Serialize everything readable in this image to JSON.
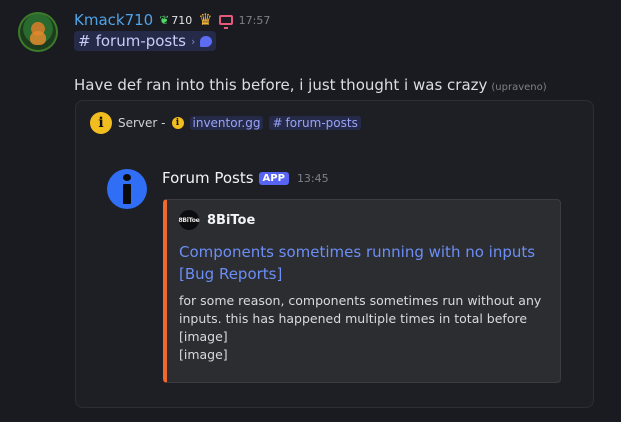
{
  "message": {
    "username": "Kmack710",
    "score": "710",
    "timestamp": "17:57",
    "channel_pill": "forum-posts",
    "text": "Have def ran into this before, i just thought i was crazy",
    "edited_label": "(upraveno)"
  },
  "embed": {
    "server_label": "Server -",
    "server_link": "inventor.gg",
    "channel_link": "forum-posts",
    "bot_name": "Forum Posts",
    "app_tag": "APP",
    "bot_time": "13:45",
    "author_icon_text": "8BiToe",
    "author": "8BiToe",
    "title": "Components sometimes running with no inputs [Bug Reports]",
    "description_lines": [
      "for some reason, components sometimes run without any",
      "inputs. this has happened multiple times in total before",
      "[image]",
      "[image]"
    ],
    "accent_color": "#f0682b"
  },
  "icons": {
    "leaf": "leaf-icon",
    "crown": "crown-icon",
    "monitor": "monitor-icon",
    "hash": "hash-icon",
    "chat_bubble": "chat-bubble-icon",
    "info": "info-icon"
  },
  "colors": {
    "username": "#4fa3e8",
    "link": "#9aa3f7",
    "title_link": "#6c8ef5",
    "app_tag": "#5865f2"
  }
}
